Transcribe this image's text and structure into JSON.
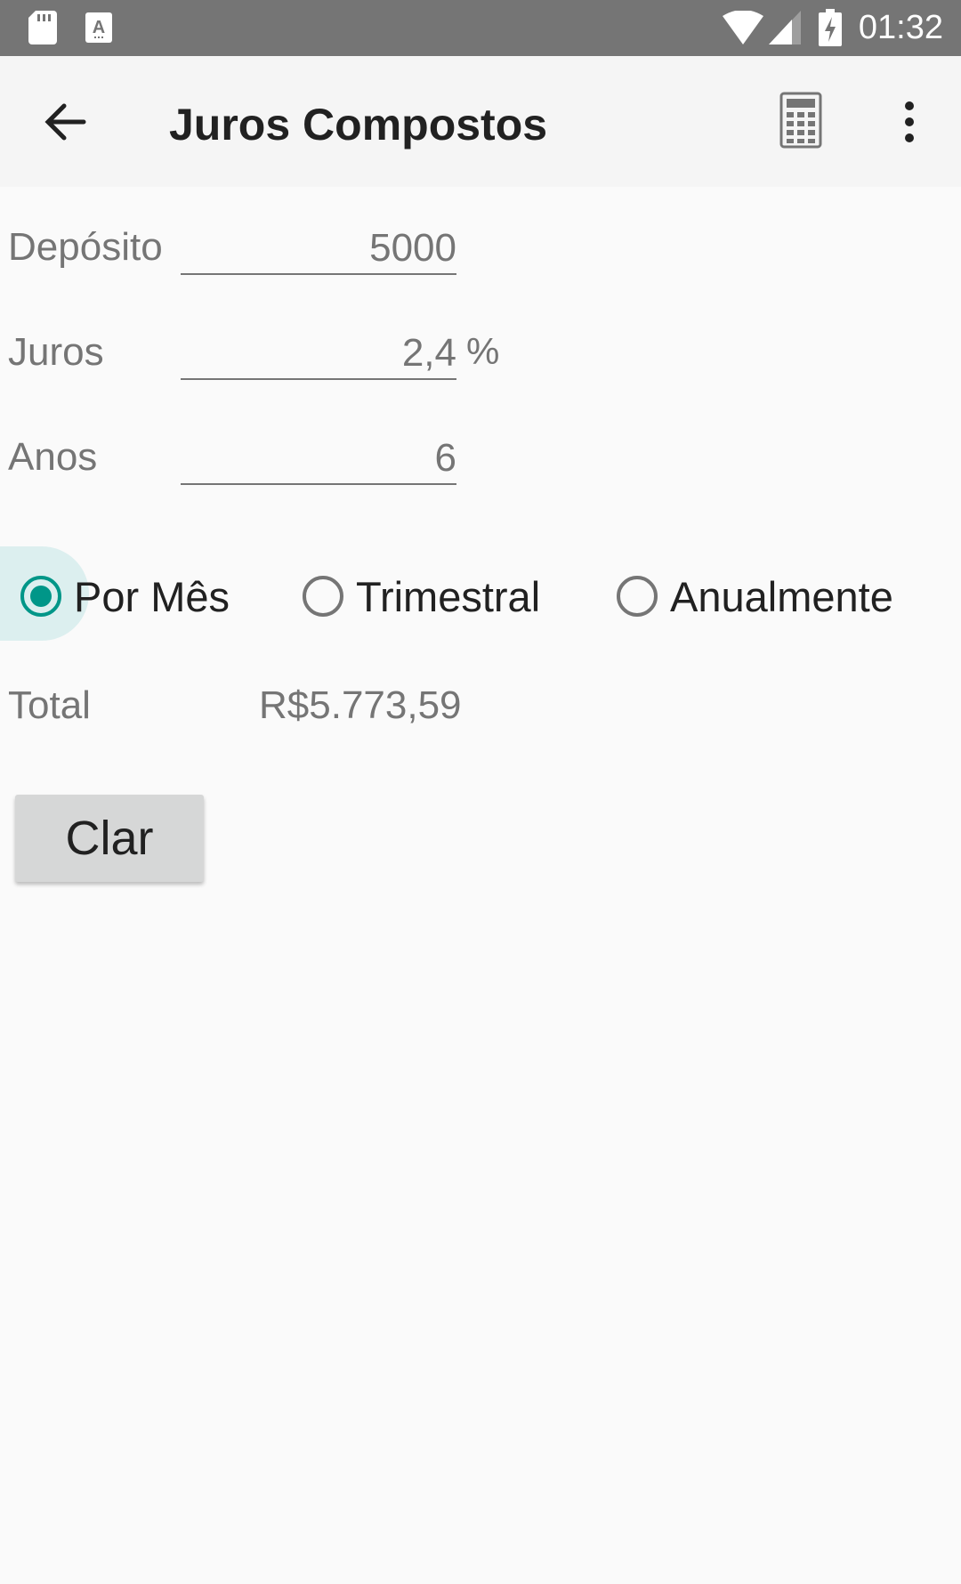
{
  "status_bar": {
    "time": "01:32",
    "icons": [
      "sd-card-icon",
      "keyboard-a-icon",
      "wifi-icon",
      "signal-icon",
      "battery-charging-icon"
    ]
  },
  "toolbar": {
    "title": "Juros Compostos",
    "back_icon": "arrow-left-icon",
    "calc_icon": "calculator-icon",
    "more_icon": "more-vert-icon"
  },
  "form": {
    "deposit_label": "Depósito",
    "deposit_value": "5000",
    "rate_label": "Juros",
    "rate_value": "2,4",
    "rate_unit": "%",
    "years_label": "Anos",
    "years_value": "6"
  },
  "frequency": {
    "options": [
      {
        "label": "Por Mês",
        "checked": true
      },
      {
        "label": "Trimestral",
        "checked": false
      },
      {
        "label": "Anualmente",
        "checked": false
      }
    ]
  },
  "result": {
    "total_label": "Total",
    "total_value": "R$5.773,59"
  },
  "actions": {
    "clear_label": "Clar"
  },
  "colors": {
    "accent": "#009688",
    "status_bar": "#757575",
    "toolbar": "#f5f5f5",
    "background": "#fafafa"
  }
}
